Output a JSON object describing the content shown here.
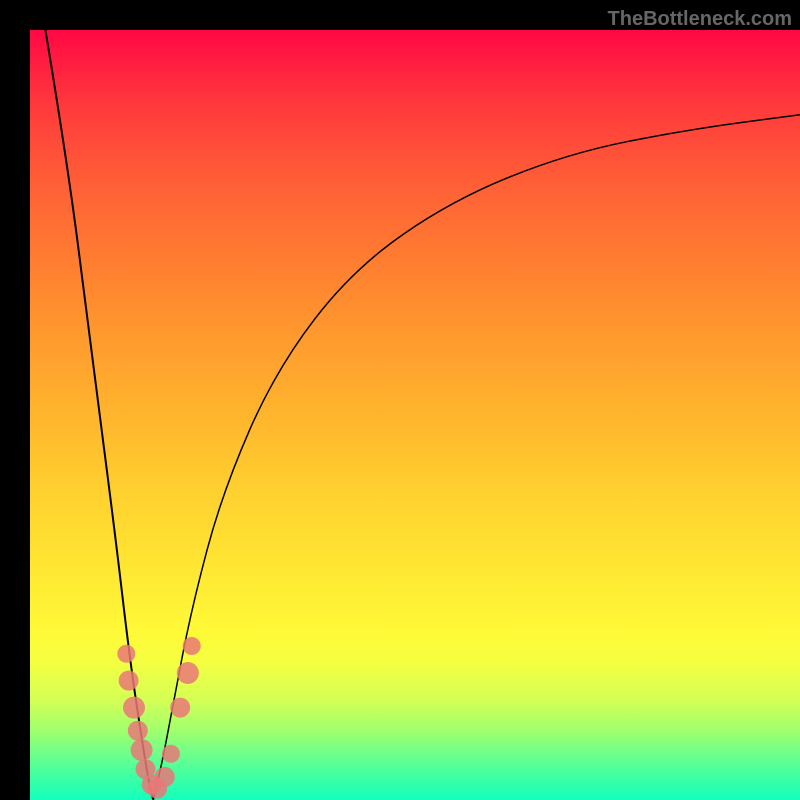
{
  "watermark": "TheBottleneck.com",
  "chart_data": {
    "type": "line",
    "title": "",
    "xlabel": "",
    "ylabel": "",
    "description": "Bottleneck profile showing two curves descending to a minimum near x≈0.15 then rising, with data points clustered near the trough",
    "left_curve": {
      "x": [
        0.02,
        0.05,
        0.08,
        0.11,
        0.13,
        0.145,
        0.155,
        0.16
      ],
      "y": [
        1.0,
        0.82,
        0.58,
        0.35,
        0.18,
        0.08,
        0.02,
        0.0
      ]
    },
    "right_curve": {
      "x": [
        0.16,
        0.17,
        0.185,
        0.21,
        0.25,
        0.32,
        0.42,
        0.55,
        0.7,
        0.85,
        1.0
      ],
      "y": [
        0.0,
        0.04,
        0.12,
        0.25,
        0.4,
        0.56,
        0.69,
        0.78,
        0.84,
        0.87,
        0.89
      ]
    },
    "data_points": [
      {
        "x": 0.125,
        "y": 0.19,
        "r": 9
      },
      {
        "x": 0.128,
        "y": 0.155,
        "r": 10
      },
      {
        "x": 0.135,
        "y": 0.12,
        "r": 11
      },
      {
        "x": 0.14,
        "y": 0.09,
        "r": 10
      },
      {
        "x": 0.145,
        "y": 0.065,
        "r": 11
      },
      {
        "x": 0.15,
        "y": 0.04,
        "r": 10
      },
      {
        "x": 0.158,
        "y": 0.02,
        "r": 10
      },
      {
        "x": 0.165,
        "y": 0.015,
        "r": 10
      },
      {
        "x": 0.175,
        "y": 0.03,
        "r": 10
      },
      {
        "x": 0.183,
        "y": 0.06,
        "r": 9
      },
      {
        "x": 0.195,
        "y": 0.12,
        "r": 10
      },
      {
        "x": 0.205,
        "y": 0.165,
        "r": 11
      },
      {
        "x": 0.21,
        "y": 0.2,
        "r": 9
      }
    ],
    "xlim": [
      0,
      1
    ],
    "ylim": [
      0,
      1
    ]
  }
}
